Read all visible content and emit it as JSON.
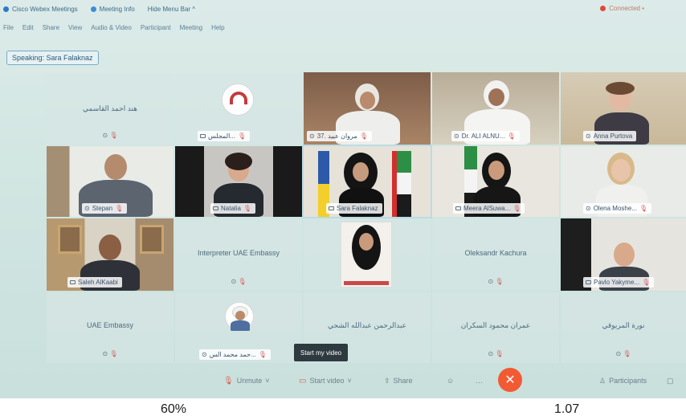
{
  "topbar": {
    "app_title": "Cisco Webex Meetings",
    "meeting_info": "Meeting Info",
    "hide_menu": "Hide Menu Bar ^",
    "connection": "Connected •"
  },
  "menubar": [
    "File",
    "Edit",
    "Share",
    "View",
    "Audio & Video",
    "Participant",
    "Meeting",
    "Help"
  ],
  "speaking": "Speaking: Sara Falaknaz",
  "row1": {
    "name_text_1": "هند احمد القاسمي",
    "logo_label": "المجلس...",
    "video1_label": "مروان عبيد .37",
    "video2_label": "Dr. ALI ALNU...",
    "video3_label": "Anna Purtova"
  },
  "row2": {
    "labels": [
      "Stepan",
      "Natalia",
      "Sara Falaknaz",
      "Meera AlSuwa...",
      "Olena Moshe..."
    ]
  },
  "row3": {
    "label_1": "Saleh AlKaabi",
    "name_text_1": "Interpreter UAE Embassy",
    "name_text_2": "Oleksandr Kachura",
    "label_2": "Pavlo Yakyme..."
  },
  "row4": {
    "name_1": "UAE Embassy",
    "avatar_label": "حمد محمد الس...",
    "name_3": "عبدالرحمن عبدالله الشحي",
    "name_4": "عمران محمود السكران",
    "name_5": "نورة المريوقي"
  },
  "tooltip": "Start my video",
  "toolbar": {
    "unmute": "Unmute",
    "start_video": "Start video",
    "share": "Share",
    "participants": "Participants"
  },
  "bottom": {
    "left_num": "60%",
    "right_num": "1.07"
  },
  "colors": {
    "end_button": "#f25a33",
    "mute_red": "#d35b5b",
    "accent": "#3c6a8a"
  }
}
